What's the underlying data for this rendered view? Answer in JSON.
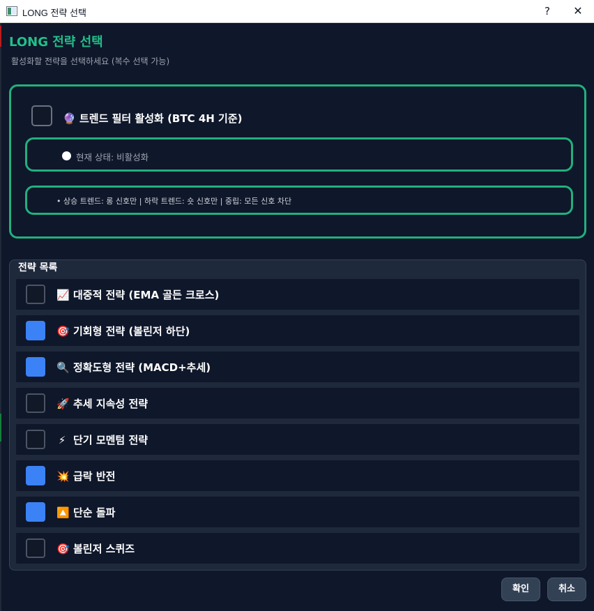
{
  "window": {
    "title": "LONG 전략 선택",
    "help_label": "?",
    "close_label": "✕"
  },
  "header": {
    "title": "LONG 전략 선택",
    "subtitle": "활성화할 전략을 선택하세요 (복수 선택 가능)"
  },
  "trend_filter": {
    "checked": false,
    "icon": "🔮",
    "label": "트렌드 필터 활성화 (BTC 4H 기준)",
    "status_text": "현재 상태: 비활성화",
    "description": "• 상승 트렌드: 롱 신호만 | 하락 트렌드: 숏 신호만 | 중립: 모든 신호 차단"
  },
  "strategy_group": {
    "title": "전략 목록",
    "items": [
      {
        "icon": "📈",
        "label": "대중적 전략 (EMA 골든 크로스)",
        "checked": false
      },
      {
        "icon": "🎯",
        "label": "기회형 전략 (볼린저 하단)",
        "checked": true
      },
      {
        "icon": "🔍",
        "label": "정확도형 전략 (MACD+추세)",
        "checked": true
      },
      {
        "icon": "🚀",
        "label": "추세 지속성 전략",
        "checked": false
      },
      {
        "icon": "⚡",
        "label": "단기 모멘텀 전략",
        "checked": false
      },
      {
        "icon": "💥",
        "label": "급락 반전",
        "checked": true
      },
      {
        "icon": "🔼",
        "label": "단순 돌파",
        "checked": true
      },
      {
        "icon": "🎯",
        "label": "볼린저 스퀴즈",
        "checked": false
      }
    ]
  },
  "buttons": {
    "ok": "확인",
    "cancel": "취소"
  },
  "colors": {
    "background": "#0f172a",
    "accent_green": "#22b07d",
    "checkbox_checked": "#3b82f6"
  }
}
